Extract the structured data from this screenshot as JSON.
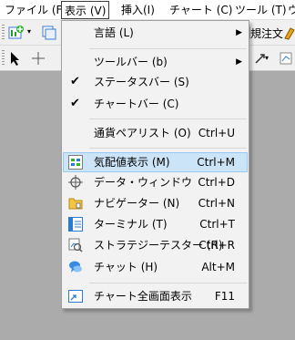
{
  "menubar": {
    "items": [
      {
        "label": "ファイル (F)"
      },
      {
        "label": "表示 (V)"
      },
      {
        "label": "挿入(I)"
      },
      {
        "label": "チャート (C)"
      },
      {
        "label": "ツール (T)"
      },
      {
        "label": "ウ"
      }
    ]
  },
  "toolbar": {
    "right_label": "規注文"
  },
  "view_menu": {
    "items": [
      {
        "label": "言語 (L)",
        "shortcut": "",
        "has_submenu": true,
        "icon": ""
      },
      {
        "label": "ツールバー (b)",
        "shortcut": "",
        "has_submenu": true,
        "icon": ""
      },
      {
        "label": "ステータスバー (S)",
        "shortcut": "",
        "checked": true,
        "icon": "check-icon"
      },
      {
        "label": "チャートバー (C)",
        "shortcut": "",
        "checked": true,
        "icon": "check-icon"
      },
      {
        "label": "通貨ペアリスト (O)",
        "shortcut": "Ctrl+U",
        "icon": ""
      },
      {
        "label": "気配値表示 (M)",
        "shortcut": "Ctrl+M",
        "highlighted": true,
        "icon": "market-watch-icon"
      },
      {
        "label": "データ・ウィンドウ",
        "shortcut": "Ctrl+D",
        "icon": "crosshair-icon"
      },
      {
        "label": "ナビゲーター (N)",
        "shortcut": "Ctrl+N",
        "icon": "navigator-icon"
      },
      {
        "label": "ターミナル (T)",
        "shortcut": "Ctrl+T",
        "icon": "terminal-icon"
      },
      {
        "label": "ストラテジーテスター (R)",
        "shortcut": "Ctrl+R",
        "icon": "strategy-tester-icon"
      },
      {
        "label": "チャット (H)",
        "shortcut": "Alt+M",
        "icon": "chat-icon"
      },
      {
        "label": "チャート全画面表示",
        "shortcut": "F11",
        "icon": "fullscreen-icon"
      }
    ]
  },
  "colors": {
    "highlight_bg": "#cce4f7",
    "highlight_border": "#99c9ef",
    "menu_bg": "#f2f2f2",
    "workspace_bg": "#ababab"
  }
}
